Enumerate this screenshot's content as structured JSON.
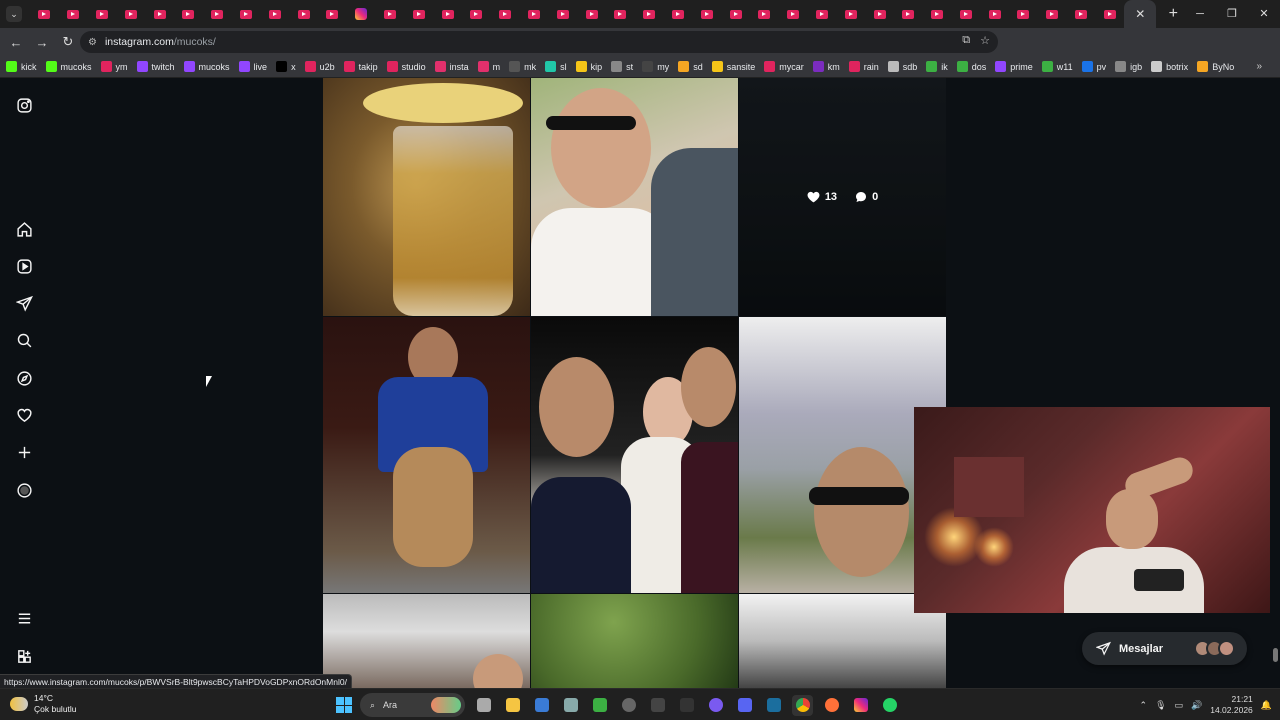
{
  "browser": {
    "tab_count": 38,
    "active_tab_close": "✕",
    "new_tab": "+",
    "window_controls": [
      "─",
      "❐",
      "✕"
    ],
    "url_host": "instagram.com",
    "url_path": "/mucoks/",
    "bookmarks": [
      {
        "label": "kick",
        "color": "#53fc18"
      },
      {
        "label": "mucoks",
        "color": "#53fc18"
      },
      {
        "label": "ym",
        "color": "#e0245e"
      },
      {
        "label": "twitch",
        "color": "#9146ff"
      },
      {
        "label": "mucoks",
        "color": "#9146ff"
      },
      {
        "label": "live",
        "color": "#9146ff"
      },
      {
        "label": "x",
        "color": "#000000"
      },
      {
        "label": "u2b",
        "color": "#e0245e"
      },
      {
        "label": "takip",
        "color": "#e0245e"
      },
      {
        "label": "studio",
        "color": "#e0245e"
      },
      {
        "label": "insta",
        "color": "#e1306c"
      },
      {
        "label": "m",
        "color": "#e1306c"
      },
      {
        "label": "mk",
        "color": "#555555"
      },
      {
        "label": "sl",
        "color": "#21c7a8"
      },
      {
        "label": "kip",
        "color": "#f5c518"
      },
      {
        "label": "st",
        "color": "#888888"
      },
      {
        "label": "my",
        "color": "#444444"
      },
      {
        "label": "sd",
        "color": "#f5a623"
      },
      {
        "label": "sansite",
        "color": "#f5c518"
      },
      {
        "label": "mycar",
        "color": "#e0245e"
      },
      {
        "label": "km",
        "color": "#7b2cbf"
      },
      {
        "label": "rain",
        "color": "#e0245e"
      },
      {
        "label": "sdb",
        "color": "#bbbbbb"
      },
      {
        "label": "ik",
        "color": "#3cb043"
      },
      {
        "label": "dos",
        "color": "#3cb043"
      },
      {
        "label": "prime",
        "color": "#9146ff"
      },
      {
        "label": "w11",
        "color": "#3cb043"
      },
      {
        "label": "pv",
        "color": "#1a73e8"
      },
      {
        "label": "igb",
        "color": "#888888"
      },
      {
        "label": "botrix",
        "color": "#cccccc"
      },
      {
        "label": "ByNo",
        "color": "#f5a623"
      }
    ],
    "bookmarks_more": "»",
    "status_url": "https://www.instagram.com/mucoks/p/BWVSrB-Blt9pwscBCyTaHPDVoGDPxnORdOnMnl0/"
  },
  "sidebar": {
    "icons": [
      "instagram-icon",
      "home-icon",
      "reels-icon",
      "messages-icon",
      "search-icon",
      "explore-icon",
      "notifications-icon",
      "create-icon",
      "profile-icon",
      "menu-icon",
      "more-apps-icon"
    ]
  },
  "grid": {
    "hovered_post": {
      "likes": "13",
      "comments": "0"
    }
  },
  "messages": {
    "label": "Mesajlar",
    "avatar_colors": [
      "#b08a78",
      "#8a6a5a",
      "#c09080"
    ]
  },
  "taskbar": {
    "temperature": "14°C",
    "weather": "Çok bulutlu",
    "search_placeholder": "Ara",
    "time": "21:21",
    "date": "14.02.2026"
  }
}
